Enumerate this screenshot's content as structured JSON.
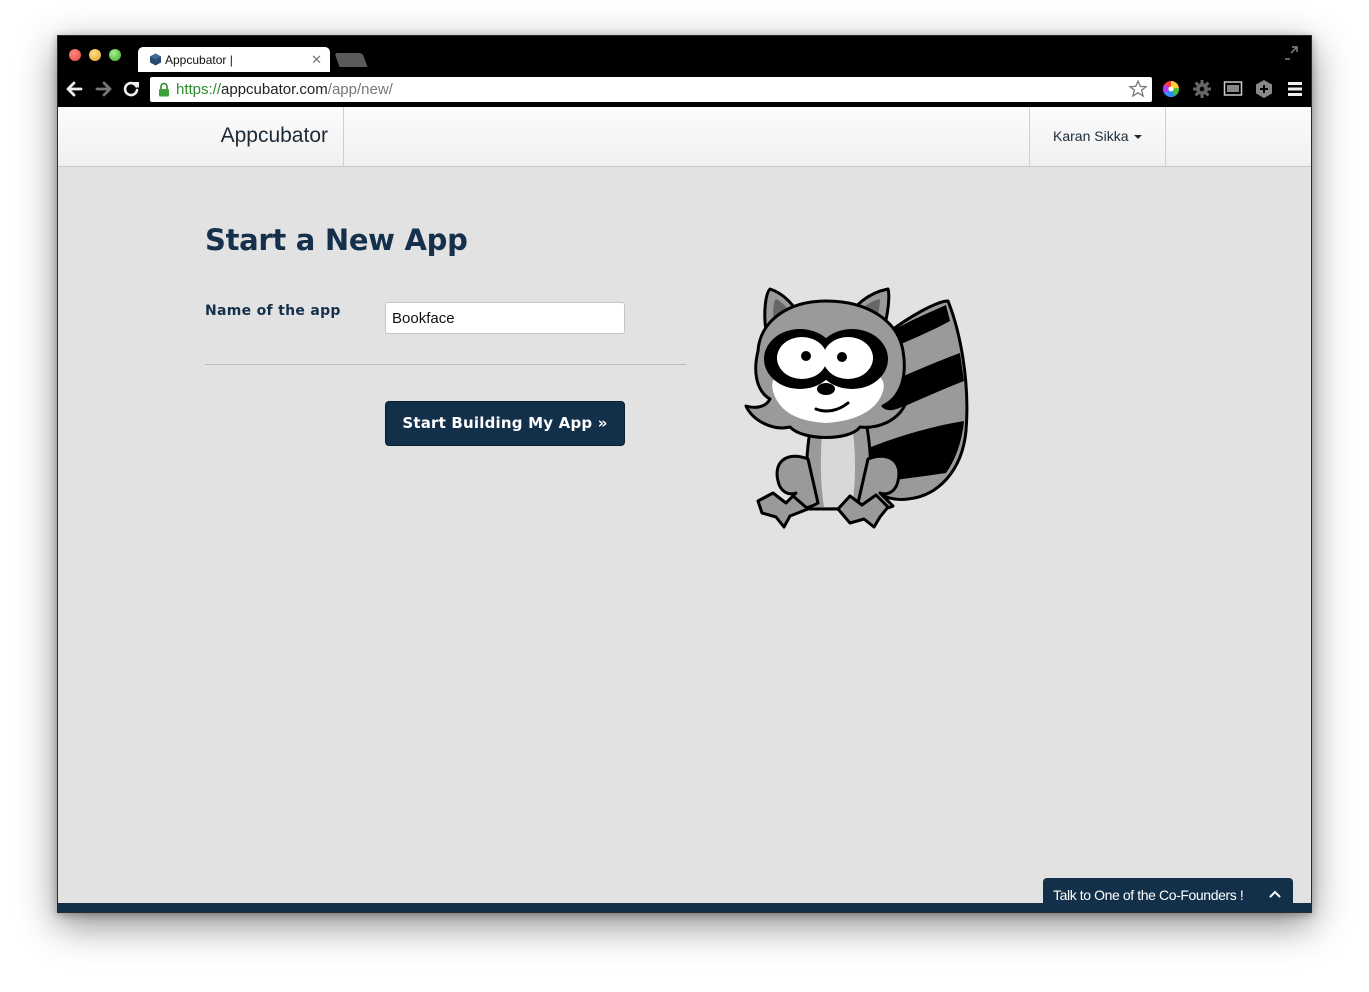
{
  "browser": {
    "tab_title": "Appcubator |",
    "url_scheme": "https://",
    "url_host": "appcubator.com",
    "url_path": "/app/new/"
  },
  "navbar": {
    "brand": "Appcubator",
    "user_name": "Karan Sikka"
  },
  "main": {
    "title": "Start a New App",
    "field_label": "Name of the app",
    "app_name_value": "Bookface",
    "submit_label": "Start Building My App »"
  },
  "footer": {
    "chat_label": "Talk to One of the Co-Founders !"
  },
  "colors": {
    "primary": "#13304a",
    "background": "#e2e2e2",
    "secure_green": "#2c8c2c"
  },
  "icons": [
    "back-arrow-icon",
    "forward-arrow-icon",
    "reload-icon",
    "lock-icon",
    "star-icon",
    "color-wheel-icon",
    "gear-icon",
    "screenshot-icon",
    "hexagon-icon",
    "menu-icon",
    "chevron-up-icon",
    "caret-down-icon"
  ]
}
